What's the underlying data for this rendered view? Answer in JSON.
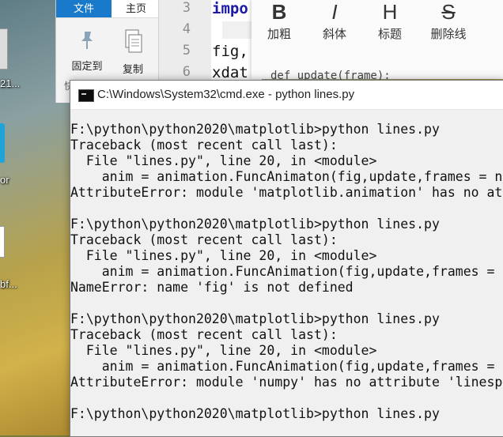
{
  "desktop": {
    "icons": [
      {
        "label": "21...",
        "icon": "document-icon"
      },
      {
        "label": "or",
        "icon": "app-icon"
      },
      {
        "label": "bf...",
        "icon": "document-icon"
      }
    ]
  },
  "explorer": {
    "tab_file": "文件",
    "tab_home": "主页",
    "buttons": [
      {
        "label": "固定到",
        "icon": "pin-icon"
      },
      {
        "label": "复制",
        "icon": "copy-icon"
      }
    ],
    "side_char": "快"
  },
  "editor": {
    "line_numbers": [
      "3",
      "4",
      "5",
      "6"
    ],
    "lines": [
      "impo",
      "",
      "fig,",
      "xdat"
    ]
  },
  "markdown_toolbar": {
    "buttons": [
      {
        "glyph": "B",
        "label": "加粗"
      },
      {
        "glyph": "I",
        "label": "斜体"
      },
      {
        "glyph": "H",
        "label": "标题"
      },
      {
        "glyph": "S",
        "label": "删除线"
      }
    ],
    "code_preview": "def update(frame):"
  },
  "cmd": {
    "title": "C:\\Windows\\System32\\cmd.exe - python  lines.py",
    "lines": [
      "F:\\python\\python2020\\matplotlib>python lines.py",
      "Traceback (most recent call last):",
      "  File \"lines.py\", line 20, in <module>",
      "    anim = animation.FuncAnimaton(fig,update,frames = n",
      "AttributeError: module 'matplotlib.animation' has no at",
      "",
      "F:\\python\\python2020\\matplotlib>python lines.py",
      "Traceback (most recent call last):",
      "  File \"lines.py\", line 20, in <module>",
      "    anim = animation.FuncAnimation(fig,update,frames =",
      "NameError: name 'fig' is not defined",
      "",
      "F:\\python\\python2020\\matplotlib>python lines.py",
      "Traceback (most recent call last):",
      "  File \"lines.py\", line 20, in <module>",
      "    anim = animation.FuncAnimation(fig,update,frames =",
      "AttributeError: module 'numpy' has no attribute 'linesp",
      "",
      "F:\\python\\python2020\\matplotlib>python lines.py"
    ]
  }
}
